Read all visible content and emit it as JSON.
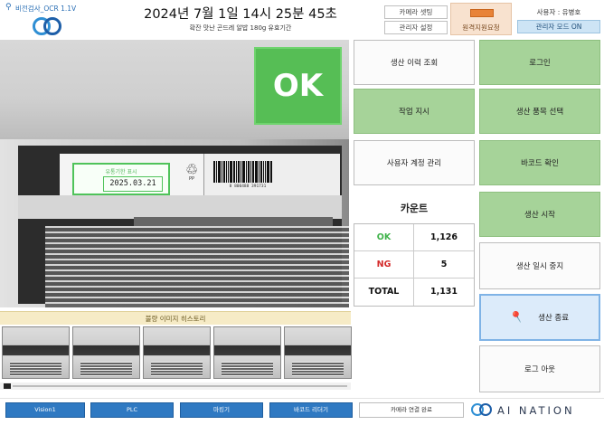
{
  "header": {
    "app_name": "비전검사_OCR 1.1V",
    "datetime": "2024년 7월 1일 14시 25분 45초",
    "product_title": "확잔 맛난 곤드레 알밥 180g 유효기간",
    "camera_settings_label": "카메라 셋팅",
    "admin_settings_label": "관리자 설정",
    "remote_support_label": "원격지원요청",
    "user_label": "사용자 : 유병호",
    "admin_mode_label": "관리자 모드 ON"
  },
  "camera": {
    "result": "OK",
    "ocr_caption": "유통기한 표시",
    "ocr_date": "2025.03.21",
    "recycle_text": "PP",
    "barcode_number": "8 800488 391731"
  },
  "history": {
    "title": "불량 이미지 히스토리",
    "thumbnails": [
      "history-1",
      "history-2",
      "history-3",
      "history-4",
      "history-5"
    ]
  },
  "buttons": {
    "production_history": "생산 이력 조회",
    "login": "로그인",
    "work_order": "작업 지시",
    "select_product": "생산 품목 선택",
    "user_account": "사용자 계정 관리",
    "barcode_check": "바코드 확인",
    "start_production": "생산 시작",
    "pause_production": "생산 일시 중지",
    "end_production": "생산 종료",
    "logout": "로그 아웃"
  },
  "count": {
    "title": "카운트",
    "rows": [
      {
        "label": "OK",
        "value": "1,126"
      },
      {
        "label": "NG",
        "value": "5"
      },
      {
        "label": "TOTAL",
        "value": "1,131"
      }
    ]
  },
  "footer": {
    "vision_label": "Vision1",
    "plc_label": "PLC",
    "printer_label": "마킹기",
    "barcode_reader_label": "바코드 리더기",
    "camera_connect_label": "카메라 연결 완료",
    "brand": "AI NATION"
  },
  "colors": {
    "ok_green": "#56be55",
    "button_green": "#a6d399",
    "footer_blue": "#2f79c2",
    "ng_red": "#d42a2a",
    "remote_orange": "#e88338"
  },
  "icons": {
    "location": "location-pin-icon",
    "pushpin": "pushpin-icon",
    "recycle": "recycle-icon"
  }
}
